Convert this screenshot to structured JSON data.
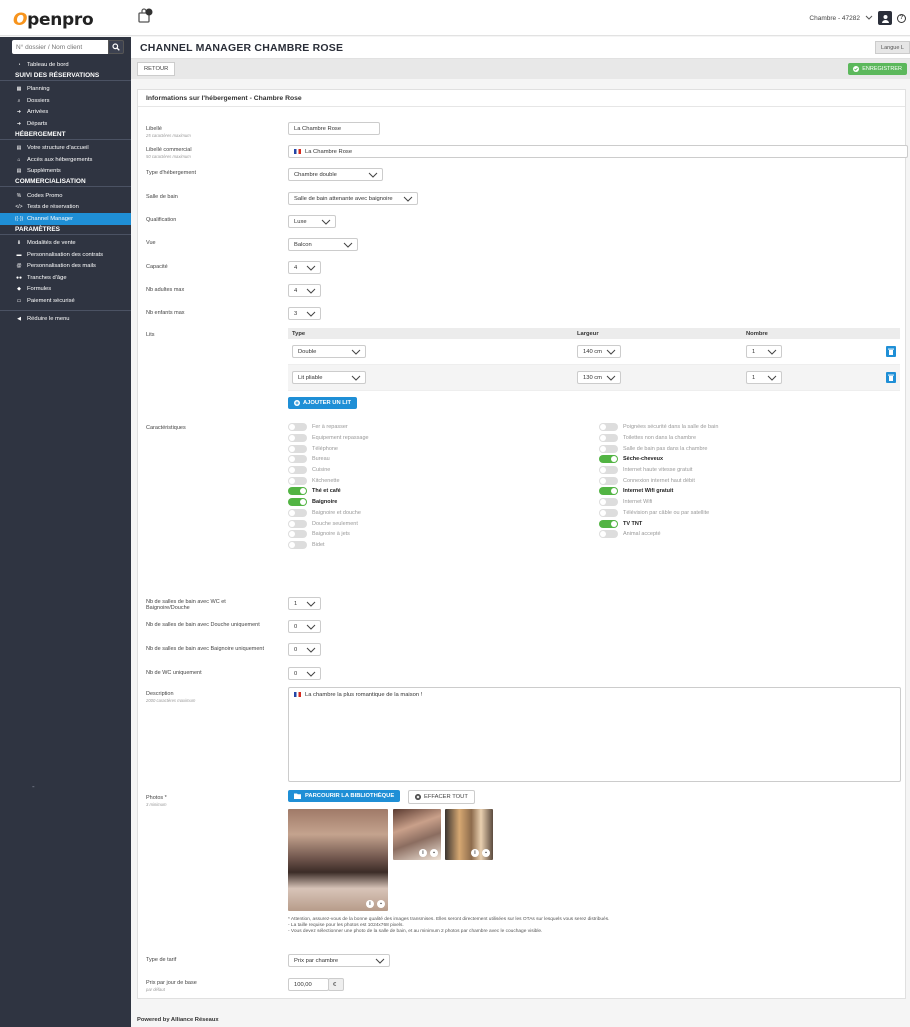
{
  "header": {
    "logo_text": "penpro",
    "room_select": "Chambre - 47282",
    "help_icon": "?"
  },
  "sidebar": {
    "search_placeholder": "N° dossier / Nom client",
    "items": [
      {
        "type": "item",
        "label": "Tableau de bord",
        "icon": "dashboard-icon"
      },
      {
        "type": "head",
        "label": "SUIVI DES RÉSERVATIONS"
      },
      {
        "type": "item",
        "label": "Planning",
        "icon": "calendar-icon"
      },
      {
        "type": "item",
        "label": "Dossiers",
        "icon": "search-icon"
      },
      {
        "type": "item",
        "label": "Arrivées",
        "icon": "sign-in-icon"
      },
      {
        "type": "item",
        "label": "Départs",
        "icon": "sign-out-icon"
      },
      {
        "type": "head",
        "label": "HÉBERGEMENT"
      },
      {
        "type": "item",
        "label": "Votre structure d'accueil",
        "icon": "document-icon"
      },
      {
        "type": "item",
        "label": "Accès aux hébergements",
        "icon": "home-icon"
      },
      {
        "type": "item",
        "label": "Suppléments",
        "icon": "document-icon"
      },
      {
        "type": "head",
        "label": "COMMERCIALISATION"
      },
      {
        "type": "item",
        "label": "Codes Promo",
        "icon": "percent-icon"
      },
      {
        "type": "item",
        "label": "Tests de réservation",
        "icon": "code-icon"
      },
      {
        "type": "item",
        "label": "Channel Manager",
        "icon": "antenna-icon",
        "active": true
      },
      {
        "type": "head",
        "label": "PARAMÈTRES"
      },
      {
        "type": "item",
        "label": "Modalités de vente",
        "icon": "download-icon"
      },
      {
        "type": "item",
        "label": "Personnalisation des contrats",
        "icon": "folder-icon"
      },
      {
        "type": "item",
        "label": "Personnalisation des mails",
        "icon": "at-icon"
      },
      {
        "type": "item",
        "label": "Tranches d'âge",
        "icon": "users-icon"
      },
      {
        "type": "item",
        "label": "Formules",
        "icon": "tag-icon"
      },
      {
        "type": "item",
        "label": "Paiement sécurisé",
        "icon": "credit-card-icon"
      },
      {
        "type": "sep"
      },
      {
        "type": "item",
        "label": "Réduire le menu",
        "icon": "chevron-left-circle-icon"
      }
    ],
    "dash": "-"
  },
  "page": {
    "title": "CHANNEL MANAGER CHAMBRE ROSE",
    "lang_button": "Langue L",
    "back_button": "RETOUR",
    "save_button": "ENREGISTRER",
    "card_title": "Informations sur l'hébergement - Chambre Rose"
  },
  "form": {
    "libelle_label": "Libellé",
    "libelle_hint": "25 caractères maximum",
    "libelle_value": "La Chambre Rose",
    "libelle_com_label": "Libellé commercial",
    "libelle_com_hint": "50 caractères maximum",
    "libelle_com_value": "La Chambre Rose",
    "type_label": "Type d'hébergement",
    "type_value": "Chambre double",
    "sdb_label": "Salle de bain",
    "sdb_value": "Salle de bain attenante avec baignoire",
    "qualif_label": "Qualification",
    "qualif_value": "Luxe",
    "vue_label": "Vue",
    "vue_value": "Balcon",
    "capacite_label": "Capacité",
    "capacite_value": "4",
    "adultes_label": "Nb adultes max",
    "adultes_value": "4",
    "enfants_label": "Nb enfants max",
    "enfants_value": "3",
    "lits_label": "Lits",
    "lits_headers": {
      "type": "Type",
      "largeur": "Largeur",
      "nombre": "Nombre"
    },
    "lits_rows": [
      {
        "type": "Double",
        "largeur": "140 cm",
        "nombre": "1"
      },
      {
        "type": "Lit pliable",
        "largeur": "130 cm",
        "nombre": "1"
      }
    ],
    "add_bed_button": "AJOUTER UN LIT",
    "carac_label": "Caractéristiques",
    "carac_left": [
      {
        "label": "Fer à repasser",
        "on": false
      },
      {
        "label": "Equipement repassage",
        "on": false
      },
      {
        "label": "Téléphone",
        "on": false
      },
      {
        "label": "Bureau",
        "on": false
      },
      {
        "label": "Cuisine",
        "on": false
      },
      {
        "label": "Kitchenette",
        "on": false
      },
      {
        "label": "Thé et café",
        "on": true
      },
      {
        "label": "Baignoire",
        "on": true
      },
      {
        "label": "Baignoire et douche",
        "on": false
      },
      {
        "label": "Douche seulement",
        "on": false
      },
      {
        "label": "Baignoire à jets",
        "on": false
      },
      {
        "label": "Bidet",
        "on": false
      }
    ],
    "carac_right": [
      {
        "label": "Poignées sécurité dans la salle de bain",
        "on": false
      },
      {
        "label": "Toilettes non dans la chambre",
        "on": false
      },
      {
        "label": "Salle de bain pas dans la chambre",
        "on": false
      },
      {
        "label": "Sèche-cheveux",
        "on": true
      },
      {
        "label": "Internet haute vitesse gratuit",
        "on": false
      },
      {
        "label": "Connexion internet haut débit",
        "on": false
      },
      {
        "label": "Internet Wifi gratuit",
        "on": true
      },
      {
        "label": "Internet Wifi",
        "on": false
      },
      {
        "label": "Télévision par câble ou par satellite",
        "on": false
      },
      {
        "label": "TV TNT",
        "on": true
      },
      {
        "label": "Animal accepté",
        "on": false
      }
    ],
    "sdb_wc_label": "Nb de salles de bain avec WC et Baignoire/Douche",
    "sdb_wc_value": "1",
    "sdb_douche_label": "Nb de salles de bain avec Douche uniquement",
    "sdb_douche_value": "0",
    "sdb_baignoire_label": "Nb de salles de bain avec Baignoire uniquement",
    "sdb_baignoire_value": "0",
    "wc_label": "Nb de WC uniquement",
    "wc_value": "0",
    "desc_label": "Description",
    "desc_hint": "2000 caractères maximum",
    "desc_value": "La chambre la plus romantique de la maison !",
    "photos_label": "Photos *",
    "photos_hint": "3 minimum",
    "browse_button": "PARCOURIR LA BIBLIOTHÈQUE",
    "clear_button": "EFFACER TOUT",
    "notes": [
      "* Attention, assurez-vous de la bonne qualité des images transmises. Elles seront directement utilisées sur les OTAs sur lesquels vous serez distribués.",
      "- La taille requise pour les photos est 1024x768 pixels.",
      "- Vous devez sélectionner une photo de la salle de bain, et au minimum 2 photos par chambre avec le couchage visible."
    ],
    "tarif_label": "Type de tarif",
    "tarif_value": "Prix par chambre",
    "prix_label": "Prix par jour de base",
    "prix_hint": "par défaut",
    "prix_value": "100,00",
    "currency": "€"
  },
  "footer": "Powered by Alliance Réseaux",
  "colors": {
    "accent": "#1f8fd6",
    "sidebar": "#2f3441",
    "save": "#5cb85c",
    "toggle_on": "#52b443"
  }
}
